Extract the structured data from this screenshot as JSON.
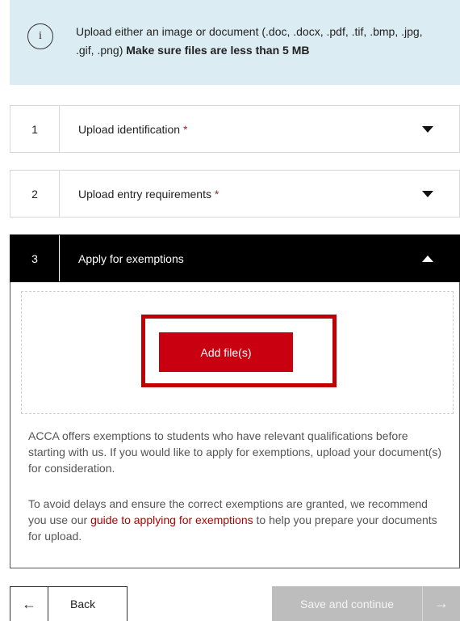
{
  "info": {
    "icon": "info-icon",
    "icon_glyph": "i",
    "text": "Upload either an image or document (.doc, .docx, .pdf, .tif, .bmp, .jpg, .gif, .png)",
    "bold_text": "Make sure files are less than 5 MB"
  },
  "steps": [
    {
      "number": "1",
      "title": "Upload identification",
      "required_marker": "*",
      "state": "collapsed"
    },
    {
      "number": "2",
      "title": "Upload entry requirements",
      "required_marker": "*",
      "state": "collapsed"
    },
    {
      "number": "3",
      "title": "Apply for exemptions",
      "state": "expanded"
    }
  ],
  "panel": {
    "add_button_label": "Add file(s)",
    "paragraph_1": "ACCA offers exemptions to students who have relevant qualifications before starting with us. If you would like to apply for exemptions, upload your document(s) for consideration.",
    "paragraph_2_before": "To avoid delays and ensure the correct exemptions are granted, we recommend you use our",
    "paragraph_2_link": "guide to applying for exemptions",
    "paragraph_2_after": "to help you prepare your documents for upload."
  },
  "footer": {
    "back_label": "Back",
    "back_icon": "arrow-left-icon",
    "save_label": "Save and continue",
    "save_icon": "arrow-right-icon"
  },
  "colors": {
    "accent_red": "#c8000f",
    "info_bg": "#dcecf3",
    "active_step_bg": "#000000",
    "disabled_button": "#bdbdbd"
  }
}
